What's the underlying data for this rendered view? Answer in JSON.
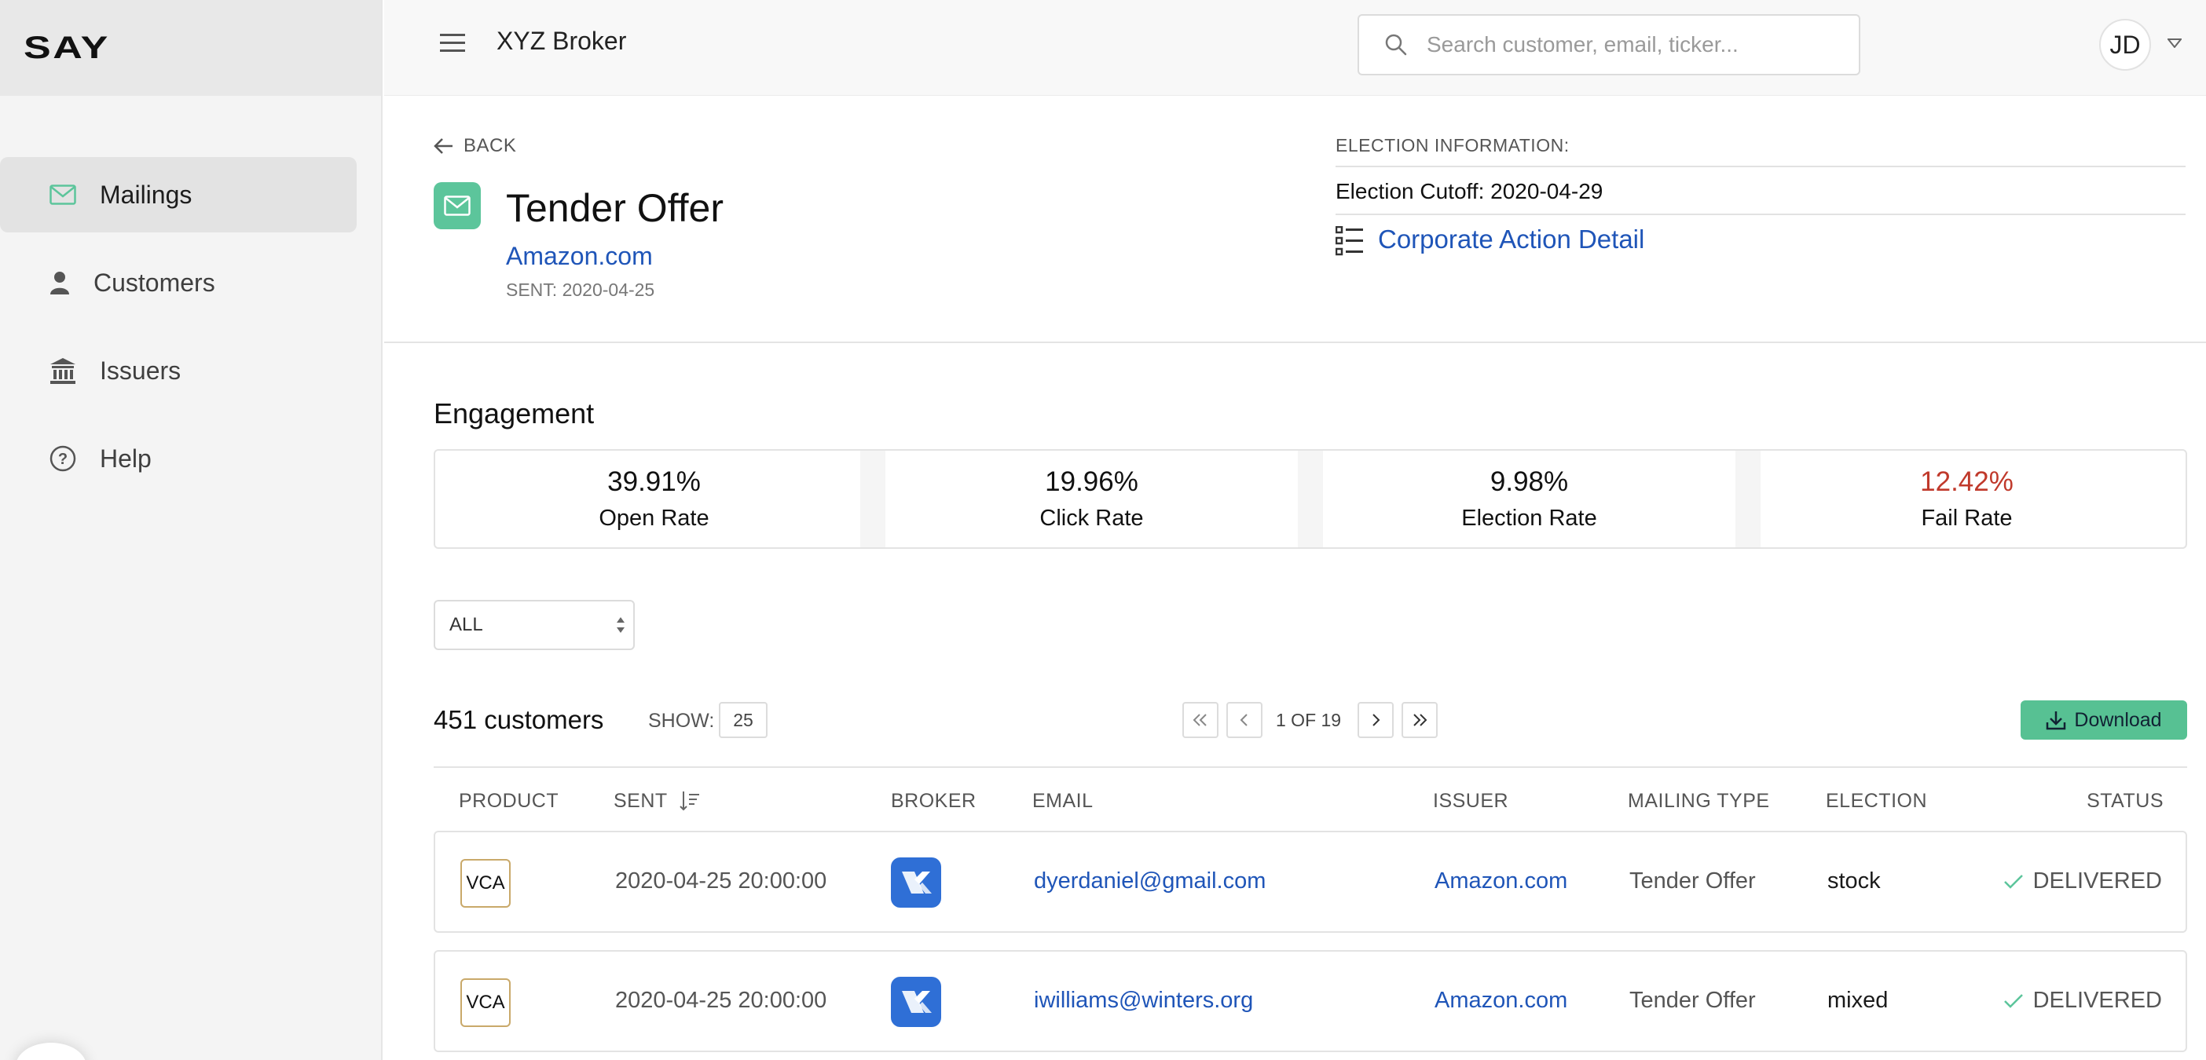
{
  "app": {
    "logo": "SAY",
    "broker_name": "XYZ Broker"
  },
  "sidebar": {
    "items": [
      {
        "label": "Mailings",
        "icon": "mail-icon",
        "active": true
      },
      {
        "label": "Customers",
        "icon": "person-icon"
      },
      {
        "label": "Issuers",
        "icon": "bank-icon"
      },
      {
        "label": "Help",
        "icon": "help-icon"
      }
    ]
  },
  "header": {
    "search_placeholder": "Search customer, email, ticker...",
    "user_initials": "JD"
  },
  "detail": {
    "back_label": "BACK",
    "title": "Tender Offer",
    "issuer": "Amazon.com",
    "sent": "SENT: 2020-04-25",
    "election_label": "ELECTION INFORMATION:",
    "election_cutoff": "Election Cutoff: 2020-04-29",
    "corporate_action_link": "Corporate Action Detail"
  },
  "engagement": {
    "title": "Engagement",
    "stats": [
      {
        "value": "39.91%",
        "label": "Open Rate"
      },
      {
        "value": "19.96%",
        "label": "Click Rate"
      },
      {
        "value": "9.98%",
        "label": "Election Rate"
      },
      {
        "value": "12.42%",
        "label": "Fail Rate"
      }
    ],
    "fail_color": "#c0392b"
  },
  "filter": {
    "selected": "ALL"
  },
  "table_toolbar": {
    "count": "451 customers",
    "show_label": "SHOW:",
    "show_value": "25",
    "page_text": "1 OF 19",
    "download_label": "Download"
  },
  "table": {
    "headers": [
      "PRODUCT",
      "SENT",
      "BROKER",
      "EMAIL",
      "ISSUER",
      "MAILING TYPE",
      "ELECTION",
      "STATUS"
    ],
    "rows": [
      {
        "product": "VCA",
        "sent": "2020-04-25 20:00:00",
        "email": "dyerdaniel@gmail.com",
        "issuer": "Amazon.com",
        "mailing_type": "Tender Offer",
        "election": "stock",
        "status": "DELIVERED"
      },
      {
        "product": "VCA",
        "sent": "2020-04-25 20:00:00",
        "email": "iwilliams@winters.org",
        "issuer": "Amazon.com",
        "mailing_type": "Tender Offer",
        "election": "mixed",
        "status": "DELIVERED"
      }
    ]
  },
  "colors": {
    "accent_green": "#5cc59b",
    "link_blue": "#1f55b8",
    "broker_blue": "#2f6fd6"
  }
}
